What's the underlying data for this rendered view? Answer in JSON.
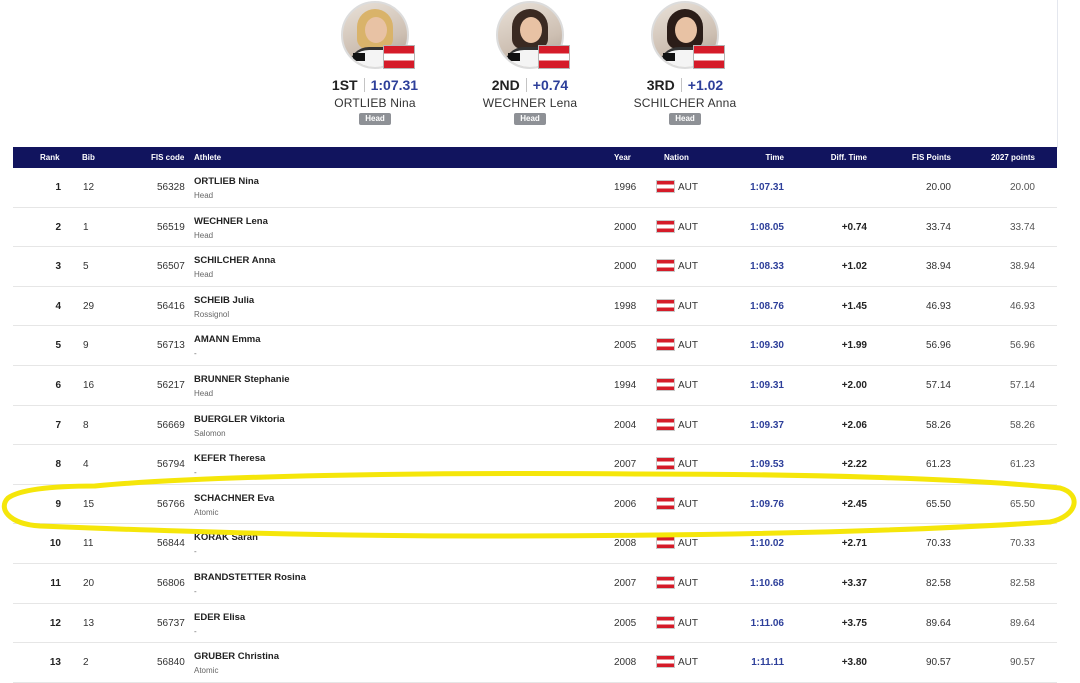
{
  "podium": [
    {
      "place": "1ST",
      "value": "1:07.31",
      "name": "ORTLIEB Nina",
      "brand": "Head",
      "hair": "#d9b36a"
    },
    {
      "place": "2ND",
      "value": "+0.74",
      "name": "WECHNER Lena",
      "brand": "Head",
      "hair": "#3a2a22"
    },
    {
      "place": "3RD",
      "value": "+1.02",
      "name": "SCHILCHER Anna",
      "brand": "Head",
      "hair": "#2b1d18"
    }
  ],
  "table": {
    "headers": {
      "rank": "Rank",
      "bib": "Bib",
      "fis_code": "FIS code",
      "athlete": "Athlete",
      "year": "Year",
      "nation": "Nation",
      "time": "Time",
      "diff": "Diff. Time",
      "fis_points": "FIS Points",
      "cup_points": "2027 points"
    },
    "rows": [
      {
        "rank": "1",
        "bib": "12",
        "fis": "56328",
        "name": "ORTLIEB Nina",
        "brand": "Head",
        "year": "1996",
        "nation": "AUT",
        "time": "1:07.31",
        "diff": "",
        "fis_points": "20.00",
        "cup_points": "20.00"
      },
      {
        "rank": "2",
        "bib": "1",
        "fis": "56519",
        "name": "WECHNER Lena",
        "brand": "Head",
        "year": "2000",
        "nation": "AUT",
        "time": "1:08.05",
        "diff": "+0.74",
        "fis_points": "33.74",
        "cup_points": "33.74"
      },
      {
        "rank": "3",
        "bib": "5",
        "fis": "56507",
        "name": "SCHILCHER Anna",
        "brand": "Head",
        "year": "2000",
        "nation": "AUT",
        "time": "1:08.33",
        "diff": "+1.02",
        "fis_points": "38.94",
        "cup_points": "38.94"
      },
      {
        "rank": "4",
        "bib": "29",
        "fis": "56416",
        "name": "SCHEIB Julia",
        "brand": "Rossignol",
        "year": "1998",
        "nation": "AUT",
        "time": "1:08.76",
        "diff": "+1.45",
        "fis_points": "46.93",
        "cup_points": "46.93"
      },
      {
        "rank": "5",
        "bib": "9",
        "fis": "56713",
        "name": "AMANN Emma",
        "brand": "-",
        "year": "2005",
        "nation": "AUT",
        "time": "1:09.30",
        "diff": "+1.99",
        "fis_points": "56.96",
        "cup_points": "56.96"
      },
      {
        "rank": "6",
        "bib": "16",
        "fis": "56217",
        "name": "BRUNNER Stephanie",
        "brand": "Head",
        "year": "1994",
        "nation": "AUT",
        "time": "1:09.31",
        "diff": "+2.00",
        "fis_points": "57.14",
        "cup_points": "57.14"
      },
      {
        "rank": "7",
        "bib": "8",
        "fis": "56669",
        "name": "BUERGLER Viktoria",
        "brand": "Salomon",
        "year": "2004",
        "nation": "AUT",
        "time": "1:09.37",
        "diff": "+2.06",
        "fis_points": "58.26",
        "cup_points": "58.26"
      },
      {
        "rank": "8",
        "bib": "4",
        "fis": "56794",
        "name": "KEFER Theresa",
        "brand": "-",
        "year": "2007",
        "nation": "AUT",
        "time": "1:09.53",
        "diff": "+2.22",
        "fis_points": "61.23",
        "cup_points": "61.23"
      },
      {
        "rank": "9",
        "bib": "15",
        "fis": "56766",
        "name": "SCHACHNER Eva",
        "brand": "Atomic",
        "year": "2006",
        "nation": "AUT",
        "time": "1:09.76",
        "diff": "+2.45",
        "fis_points": "65.50",
        "cup_points": "65.50"
      },
      {
        "rank": "10",
        "bib": "11",
        "fis": "56844",
        "name": "KORAK Sarah",
        "brand": "-",
        "year": "2008",
        "nation": "AUT",
        "time": "1:10.02",
        "diff": "+2.71",
        "fis_points": "70.33",
        "cup_points": "70.33"
      },
      {
        "rank": "11",
        "bib": "20",
        "fis": "56806",
        "name": "BRANDSTETTER Rosina",
        "brand": "-",
        "year": "2007",
        "nation": "AUT",
        "time": "1:10.68",
        "diff": "+3.37",
        "fis_points": "82.58",
        "cup_points": "82.58"
      },
      {
        "rank": "12",
        "bib": "13",
        "fis": "56737",
        "name": "EDER Elisa",
        "brand": "-",
        "year": "2005",
        "nation": "AUT",
        "time": "1:11.06",
        "diff": "+3.75",
        "fis_points": "89.64",
        "cup_points": "89.64"
      },
      {
        "rank": "13",
        "bib": "2",
        "fis": "56840",
        "name": "GRUBER Christina",
        "brand": "Atomic",
        "year": "2008",
        "nation": "AUT",
        "time": "1:11.11",
        "diff": "+3.80",
        "fis_points": "90.57",
        "cup_points": "90.57"
      }
    ]
  },
  "highlight": {
    "row_rank": "9",
    "color": "#f5e60a"
  },
  "colors": {
    "header_bg": "#11145e",
    "time_text": "#2d3f9a",
    "flag_red": "#d51b29"
  }
}
